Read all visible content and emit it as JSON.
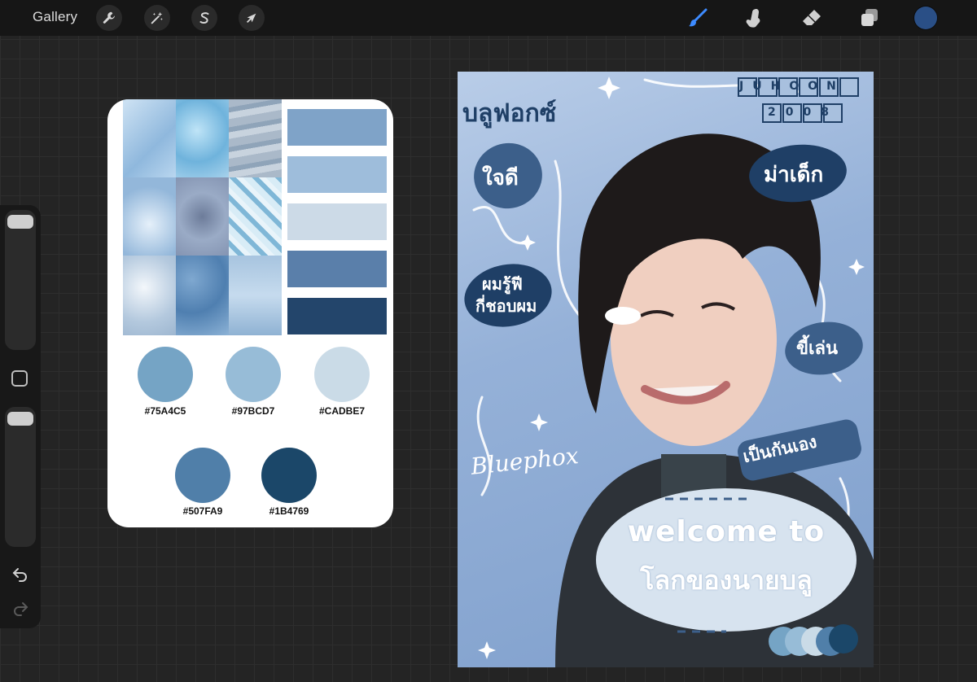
{
  "toolbar": {
    "gallery_label": "Gallery",
    "left_tools": [
      "wrench-icon",
      "magic-wand-icon",
      "selection-s-icon",
      "move-arrow-icon"
    ],
    "right_tools": [
      "brush-icon",
      "smudge-icon",
      "eraser-icon",
      "layers-icon"
    ],
    "active_color": "#2A4F86"
  },
  "palette": {
    "swatches": [
      {
        "hex": "#75A4C5",
        "color": "#75A4C5"
      },
      {
        "hex": "#97BCD7",
        "color": "#97BCD7"
      },
      {
        "hex": "#CADBE7",
        "color": "#CADBE7"
      },
      {
        "hex": "#507FA9",
        "color": "#507FA9"
      },
      {
        "hex": "#1B4769",
        "color": "#1B4769"
      }
    ],
    "strips": [
      "#7FA3C8",
      "#9EBDDB",
      "#CCDAE7",
      "#5A7FAA",
      "#23456B"
    ]
  },
  "artwork": {
    "title_thai": "บลูฟอกซ์",
    "badge_top": [
      "J",
      "U",
      "H",
      "O",
      "O",
      "N"
    ],
    "badge_bottom": [
      "2",
      "0",
      "0",
      "8"
    ],
    "sticker_1": "ใจดี",
    "sticker_2": "ม่าเด็ก",
    "sticker_3_line1": "ผมรู้ฟี",
    "sticker_3_line2": "กี่ชอบผม",
    "sticker_4": "ขี้เล่น",
    "sticker_5": "เป็นกันเอง",
    "signature": "Bluephox",
    "welcome_line1": "welcome to",
    "welcome_line2": "โลกของนายบลู"
  }
}
